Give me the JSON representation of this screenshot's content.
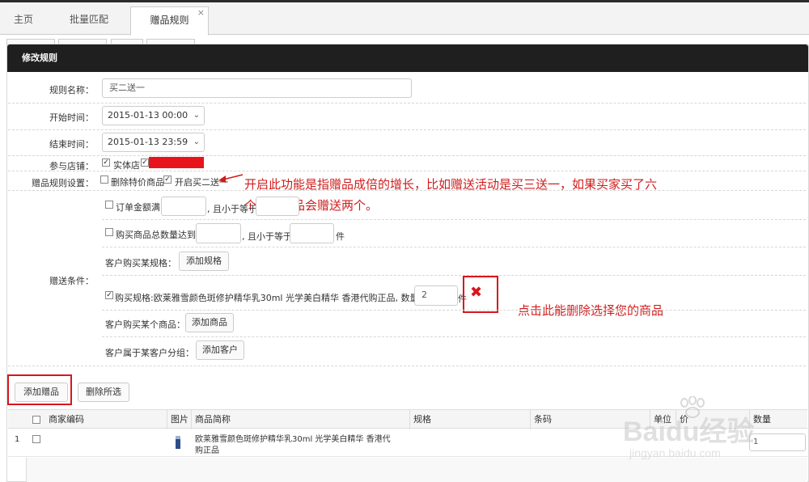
{
  "tabs": [
    {
      "label": "主页",
      "active": false
    },
    {
      "label": "批量匹配",
      "active": false
    },
    {
      "label": "赠品规则",
      "active": true,
      "close": "×"
    }
  ],
  "panel": {
    "title": "修改规则"
  },
  "form": {
    "rule_name_label": "规则名称：",
    "rule_name_value": "买二送一",
    "start_label": "开始时间：",
    "start_value": "2015-01-13 00:00",
    "end_label": "结束时间：",
    "end_value": "2015-01-13 23:59",
    "stores_label": "参与店铺：",
    "store_physical": "实体店",
    "settings_label": "赠品规则设置：",
    "exclude_special": "删除特价商品",
    "enable_multiple": "开启买二送一",
    "conditions_label": "赠送条件：",
    "order_amount_prefix": "订单金额满",
    "order_amount_suffix": ", 且小于等于",
    "qty_prefix": "购买商品总数量达到",
    "qty_suffix": ", 且小于等于",
    "qty_unit": "件",
    "spec_label": "客户购买某规格：",
    "add_spec": "添加规格",
    "spec_selected": "购买规格:欧莱雅雪颜色斑修护精华乳30ml 光学美白精华 香港代购正品, 数量达",
    "spec_qty": "2",
    "spec_unit": "件",
    "product_label": "客户购买某个商品：",
    "add_product": "添加商品",
    "group_label": "客户属于某客户分组：",
    "add_customer": "添加客户"
  },
  "actions": {
    "add_gift": "添加赠品",
    "delete_selected": "删除所选"
  },
  "annotations": {
    "line1": "开启此功能是指赠品成倍的增长，比如赠送活动是买三送一，如果买家买了六",
    "line2": "个，那赠品会赠送两个。",
    "delete_hint": "点击此能删除选择您的商品"
  },
  "table": {
    "headers": [
      "商家编码",
      "图片",
      "商品简称",
      "规格",
      "条码",
      "单位",
      "价",
      "数量"
    ],
    "rows": [
      {
        "index": "1",
        "name_line1": "欧莱雅雪颜色斑修护精华乳30ml 光学美白精华 香港代",
        "name_line2": "购正品",
        "qty": "1"
      }
    ]
  },
  "watermark": {
    "brand": "Baidu经验",
    "url": "jingyan.baidu.com"
  },
  "colors": {
    "header_bg": "#1f1f1f",
    "annotation": "#d01c1c",
    "highlight": "#e8141b"
  }
}
